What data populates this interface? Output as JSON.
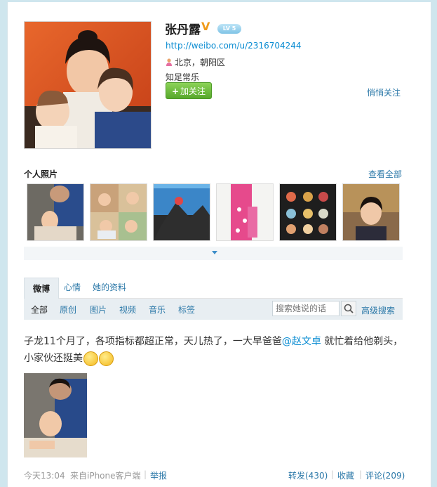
{
  "profile": {
    "name": "张丹露",
    "verified_mark": "V",
    "level": "LV 5",
    "url": "http://weibo.com/u/2316704244",
    "location": "北京，朝阳区",
    "bio": "知足常乐",
    "follow_label": "加关注",
    "quiet_follow_label": "悄悄关注"
  },
  "photos": {
    "title": "个人照片",
    "view_all": "查看全部",
    "count": 6
  },
  "tabs": [
    "微博",
    "心情",
    "她的资料"
  ],
  "filters": [
    "全部",
    "原创",
    "图片",
    "视频",
    "音乐",
    "标签"
  ],
  "search": {
    "placeholder": "搜索她说的话",
    "advanced_label": "高级搜索"
  },
  "post": {
    "text_before_mention": "子龙11个月了，各项指标都超正常，天儿热了，一大早爸爸",
    "mention": "@赵文卓",
    "text_after_mention": " 就忙着给他剃头，小家伙还挺美",
    "time": "今天13:04",
    "source": "来自iPhone客户端",
    "report": "举报",
    "repost": "转发(430)",
    "favorite": "收藏",
    "comment": "评论(209)"
  },
  "colors": {
    "link": "#2b78a8",
    "follow_green": "#57a82c",
    "verified_orange": "#f09b1a"
  }
}
